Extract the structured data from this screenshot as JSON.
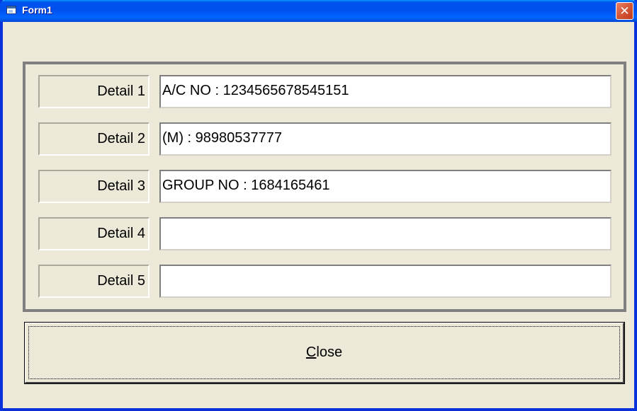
{
  "window": {
    "title": "Form1",
    "close_glyph": "✕",
    "colors": {
      "titlebar": "#0054e3",
      "face": "#ece9d8",
      "close": "#d65a3b"
    }
  },
  "details": [
    {
      "label": "Detail 1",
      "value": "A/C NO : 1234565678545151"
    },
    {
      "label": "Detail 2",
      "value": "(M) : 98980537777"
    },
    {
      "label": "Detail 3",
      "value": "GROUP NO : 1684165461"
    },
    {
      "label": "Detail 4",
      "value": ""
    },
    {
      "label": "Detail 5",
      "value": ""
    }
  ],
  "close_button": {
    "mnemonic": "C",
    "rest": "lose"
  },
  "icons": {
    "app": "form-app-icon",
    "close": "close-icon"
  }
}
